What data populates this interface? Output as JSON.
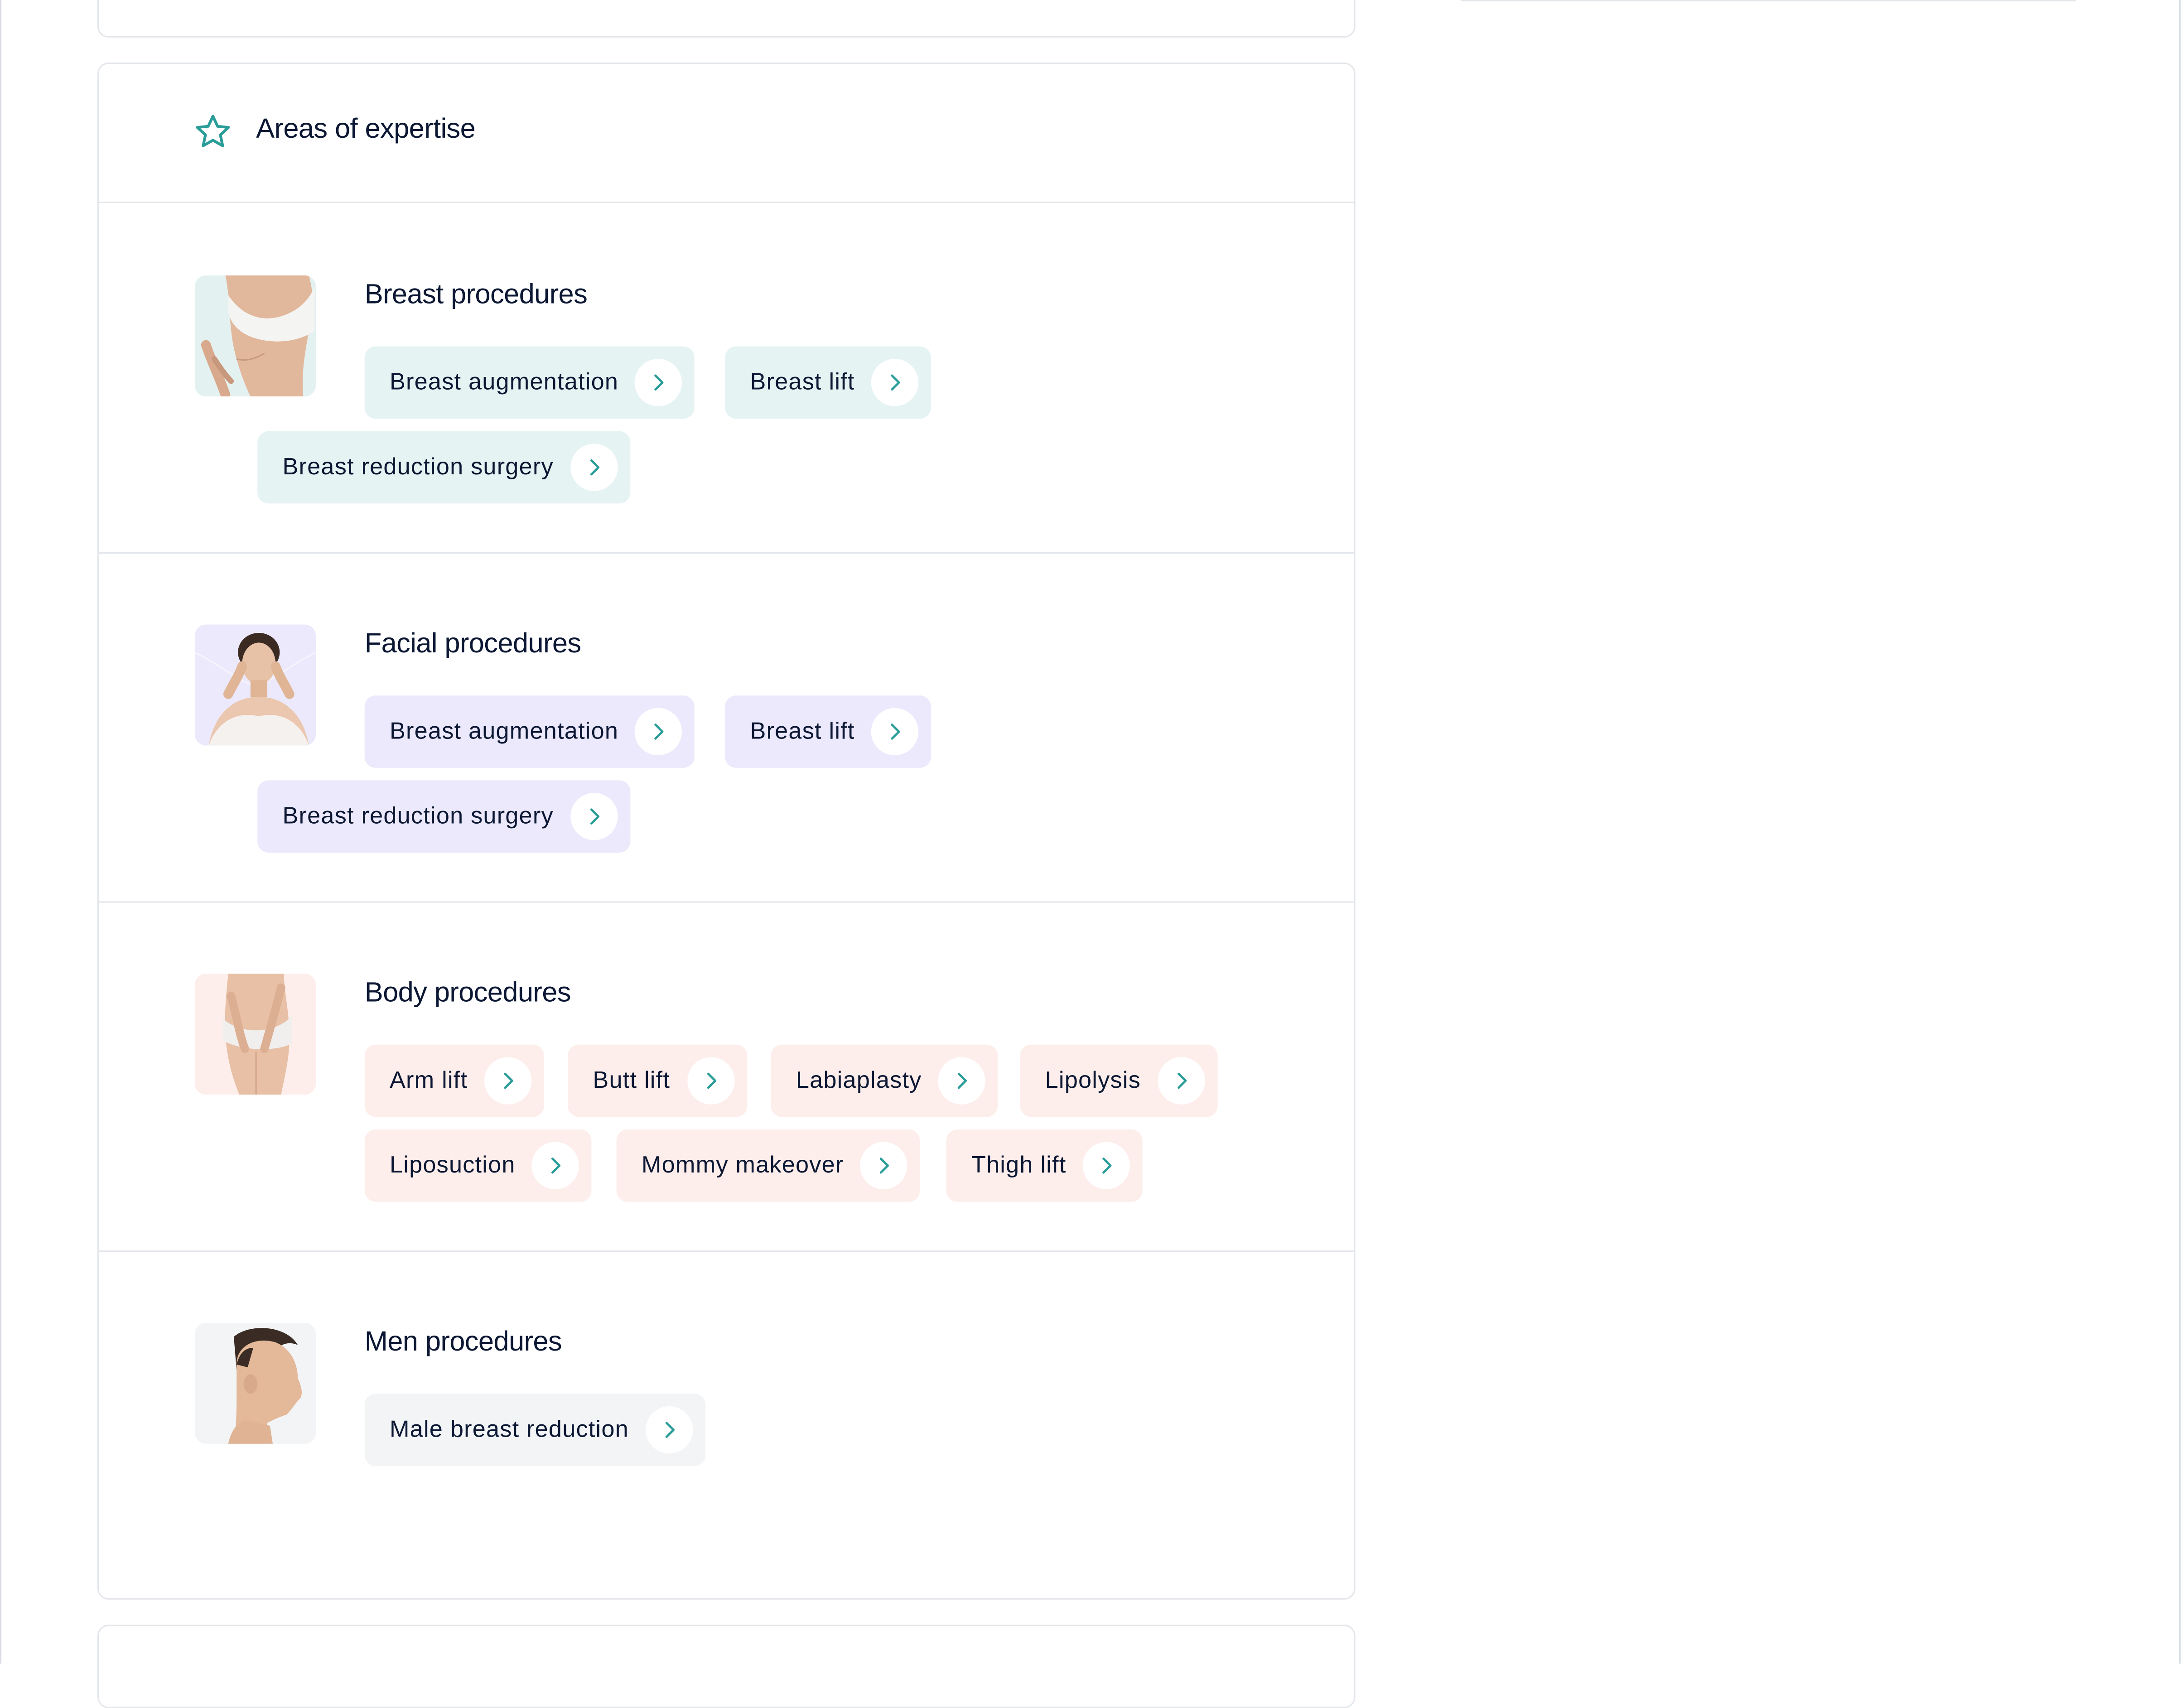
{
  "expertise": {
    "title": "Areas of expertise",
    "icon": "star-icon",
    "accent": "#2a9d99"
  },
  "sections": [
    {
      "title": "Breast procedures",
      "chip_color": "#e6f3f3",
      "items": [
        "Breast augmentation",
        "Breast lift",
        "Breast reduction surgery"
      ]
    },
    {
      "title": "Facial procedures",
      "chip_color": "#ebe9fb",
      "items": [
        "Breast augmentation",
        "Breast lift",
        "Breast reduction surgery"
      ]
    },
    {
      "title": "Body procedures",
      "chip_color": "#fdeeeb",
      "items": [
        "Arm lift",
        "Butt lift",
        "Labiaplasty",
        "Lipolysis",
        "Liposuction",
        "Mommy makeover",
        "Thigh lift"
      ]
    },
    {
      "title": "Men procedures",
      "chip_color": "#f2f4f6",
      "items": [
        "Male breast reduction"
      ]
    }
  ]
}
